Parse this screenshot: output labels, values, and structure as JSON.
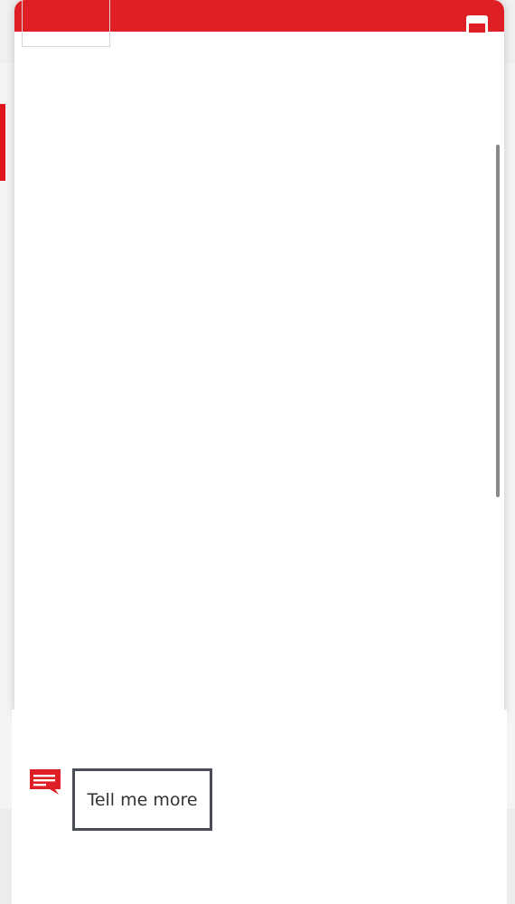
{
  "colors": {
    "accent": "#df1f26",
    "button_border": "#4a4d55"
  },
  "modal": {
    "minimize_icon": "minimize-icon",
    "logo_icon": "brand-logo"
  },
  "footer": {
    "chat_icon": "chat-bubble-icon",
    "tell_me_more_label": "Tell me more"
  }
}
